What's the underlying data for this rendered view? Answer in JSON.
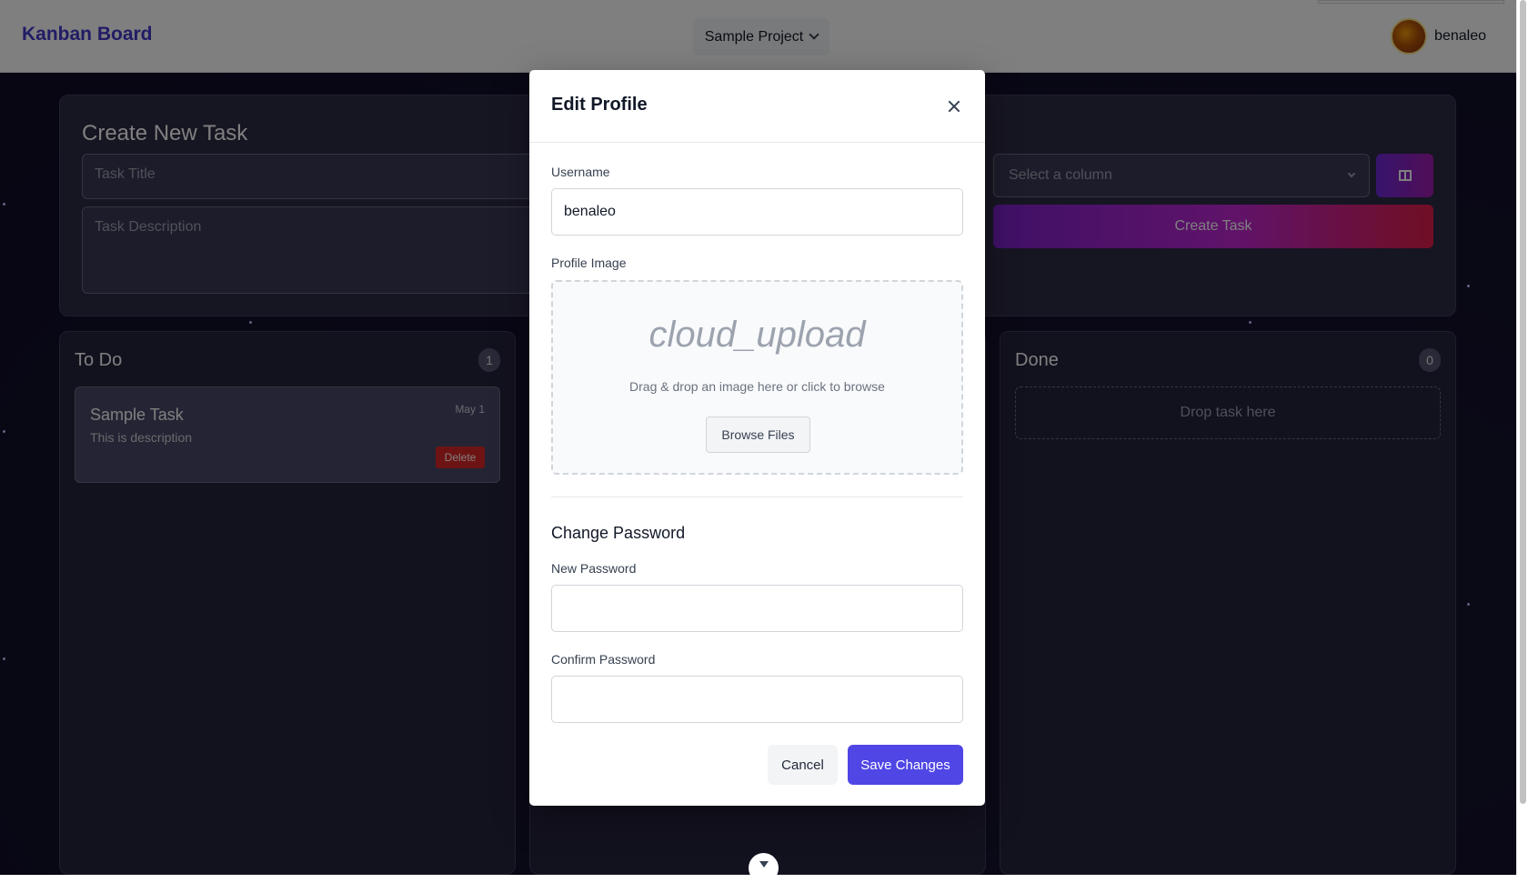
{
  "header": {
    "brand": "Kanban Board",
    "project": "Sample Project",
    "username": "benaleo"
  },
  "create_task": {
    "title": "Create New Task",
    "task_title_placeholder": "Task Title",
    "task_description_placeholder": "Task Description",
    "column_select_placeholder": "Select a column",
    "create_button": "Create Task"
  },
  "columns": [
    {
      "title": "To Do",
      "count": "1",
      "tasks": [
        {
          "title": "Sample Task",
          "description": "This is description",
          "date": "May 1",
          "delete_label": "Delete"
        }
      ]
    },
    {
      "title": "",
      "count": "",
      "tasks": []
    },
    {
      "title": "Done",
      "count": "0",
      "drop_text": "Drop task here"
    }
  ],
  "modal": {
    "title": "Edit Profile",
    "username_label": "Username",
    "username_value": "benaleo",
    "profile_image_label": "Profile Image",
    "upload_icon_text": "cloud_upload",
    "upload_hint": "Drag & drop an image here or click to browse",
    "browse_button": "Browse Files",
    "change_password_title": "Change Password",
    "new_password_label": "New Password",
    "confirm_password_label": "Confirm Password",
    "cancel_button": "Cancel",
    "save_button": "Save Changes"
  },
  "colors": {
    "brand": "#4338ca",
    "primary": "#4f46e5",
    "danger": "#dc2626",
    "board_background": "#120f2a"
  }
}
